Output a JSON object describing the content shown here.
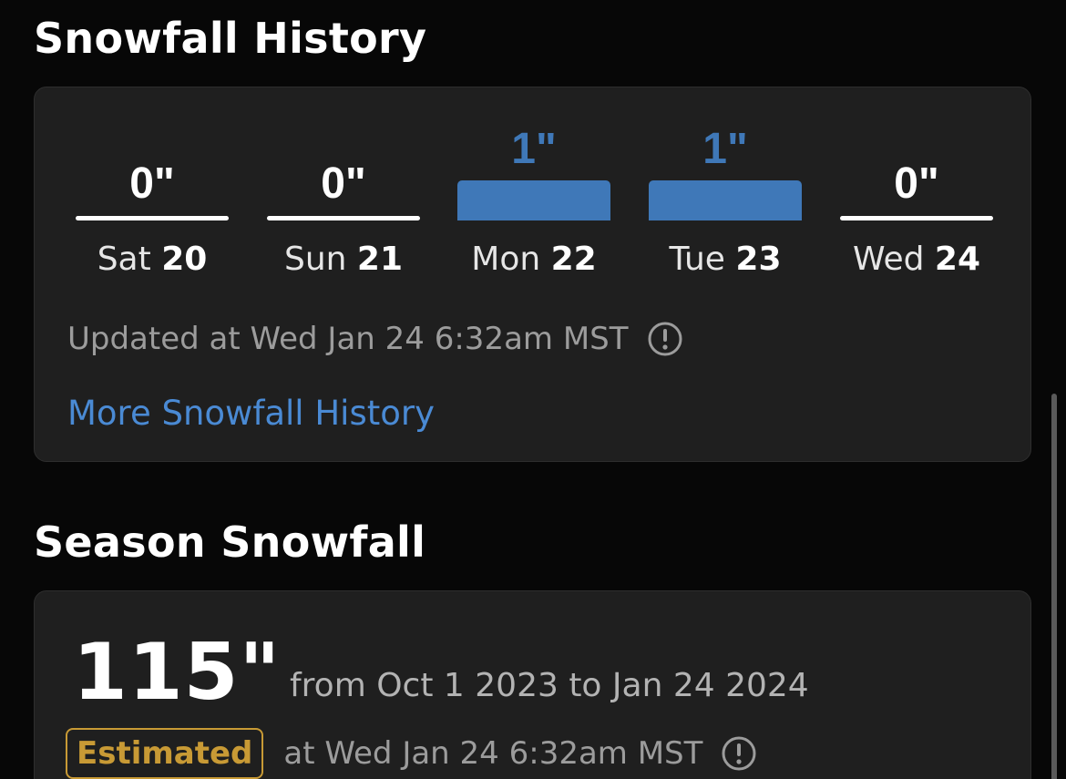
{
  "history": {
    "title": "Snowfall History",
    "days": [
      {
        "amount": "0\"",
        "inches": 0,
        "day": "Sat",
        "date": "20"
      },
      {
        "amount": "0\"",
        "inches": 0,
        "day": "Sun",
        "date": "21"
      },
      {
        "amount": "1\"",
        "inches": 1,
        "day": "Mon",
        "date": "22"
      },
      {
        "amount": "1\"",
        "inches": 1,
        "day": "Tue",
        "date": "23"
      },
      {
        "amount": "0\"",
        "inches": 0,
        "day": "Wed",
        "date": "24"
      }
    ],
    "updated": "Updated at Wed Jan 24 6:32am MST",
    "more_link": "More Snowfall History",
    "icons": {
      "info": "info-circle-icon"
    }
  },
  "season": {
    "title": "Season Snowfall",
    "total": "115\"",
    "range": "from Oct 1 2023 to Jan 24 2024",
    "badge": "Estimated",
    "estimate_text": "at Wed Jan 24 6:32am MST"
  },
  "colors": {
    "background": "#070707",
    "card": "#1f1f1f",
    "snow_bar": "#3f78b8",
    "link": "#4a8ad4",
    "badge": "#c89a35"
  }
}
